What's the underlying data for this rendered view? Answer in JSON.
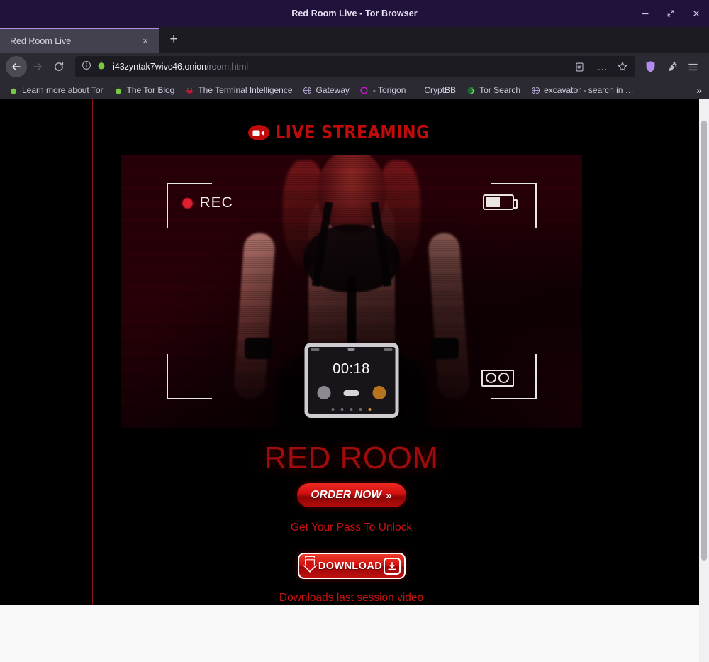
{
  "window": {
    "title": "Red Room Live - Tor Browser",
    "controls": {
      "minimize": "minimize-icon",
      "maximize": "maximize-icon",
      "close": "close-icon"
    }
  },
  "tabs": {
    "items": [
      {
        "title": "Red Room Live",
        "close_label": "×",
        "active": true
      }
    ],
    "new_tab_label": "+"
  },
  "toolbar": {
    "back_label": "←",
    "forward_label": "→",
    "reload_label": "⟳",
    "url": {
      "host": "i43zyntak7wivc46.onion",
      "path": "/room.html"
    },
    "identity_icon": "info-circle-icon",
    "onion_icon": "onion-icon",
    "reader_icon": "reader-view-icon",
    "more_label": "…",
    "bookmark_icon": "star-icon",
    "shield_icon": "shield-icon",
    "noscript_icon": "noscript-broom-icon",
    "menu_icon": "hamburger-menu-icon"
  },
  "bookmarks": {
    "items": [
      {
        "label": "Learn more about Tor",
        "icon": "onion-icon"
      },
      {
        "label": "The Tor Blog",
        "icon": "onion-icon"
      },
      {
        "label": "The Terminal Intelligence",
        "icon": "raspberry-icon"
      },
      {
        "label": "Gateway",
        "icon": "globe-icon"
      },
      {
        "label": "- Torigon",
        "icon": "circle-icon"
      },
      {
        "label": "CryptBB",
        "icon": "none"
      },
      {
        "label": "Tor Search",
        "icon": "green-onion-icon"
      },
      {
        "label": "excavator - search in …",
        "icon": "globe-icon"
      }
    ],
    "overflow_label": "»"
  },
  "page": {
    "brand": {
      "text": "LIVE STREAMING",
      "icon": "video-camera-icon"
    },
    "video": {
      "rec_label": "REC",
      "rec_dot": "record-dot-icon",
      "battery_icon": "battery-icon",
      "battery_level": "58%",
      "cassette_icon": "cassette-tape-icon",
      "tablet_timer": "00:18"
    },
    "headline": "RED ROOM",
    "order_button": {
      "label": "ORDER NOW",
      "chevron": "»"
    },
    "pass_text": "Get Your Pass To Unlock",
    "download_button": {
      "label": "DOWNLOAD",
      "arrow_icon": "down-arrow-icon",
      "box_icon": "download-icon"
    },
    "download_note": "Downloads last session video"
  },
  "colors": {
    "brand_red": "#c00b0b",
    "headline_red": "#a00c0c",
    "text_red": "#cc1111",
    "rule_red": "#8f1414",
    "tab_accent": "#b18cf0",
    "chrome_bg": "#2b2a33"
  }
}
